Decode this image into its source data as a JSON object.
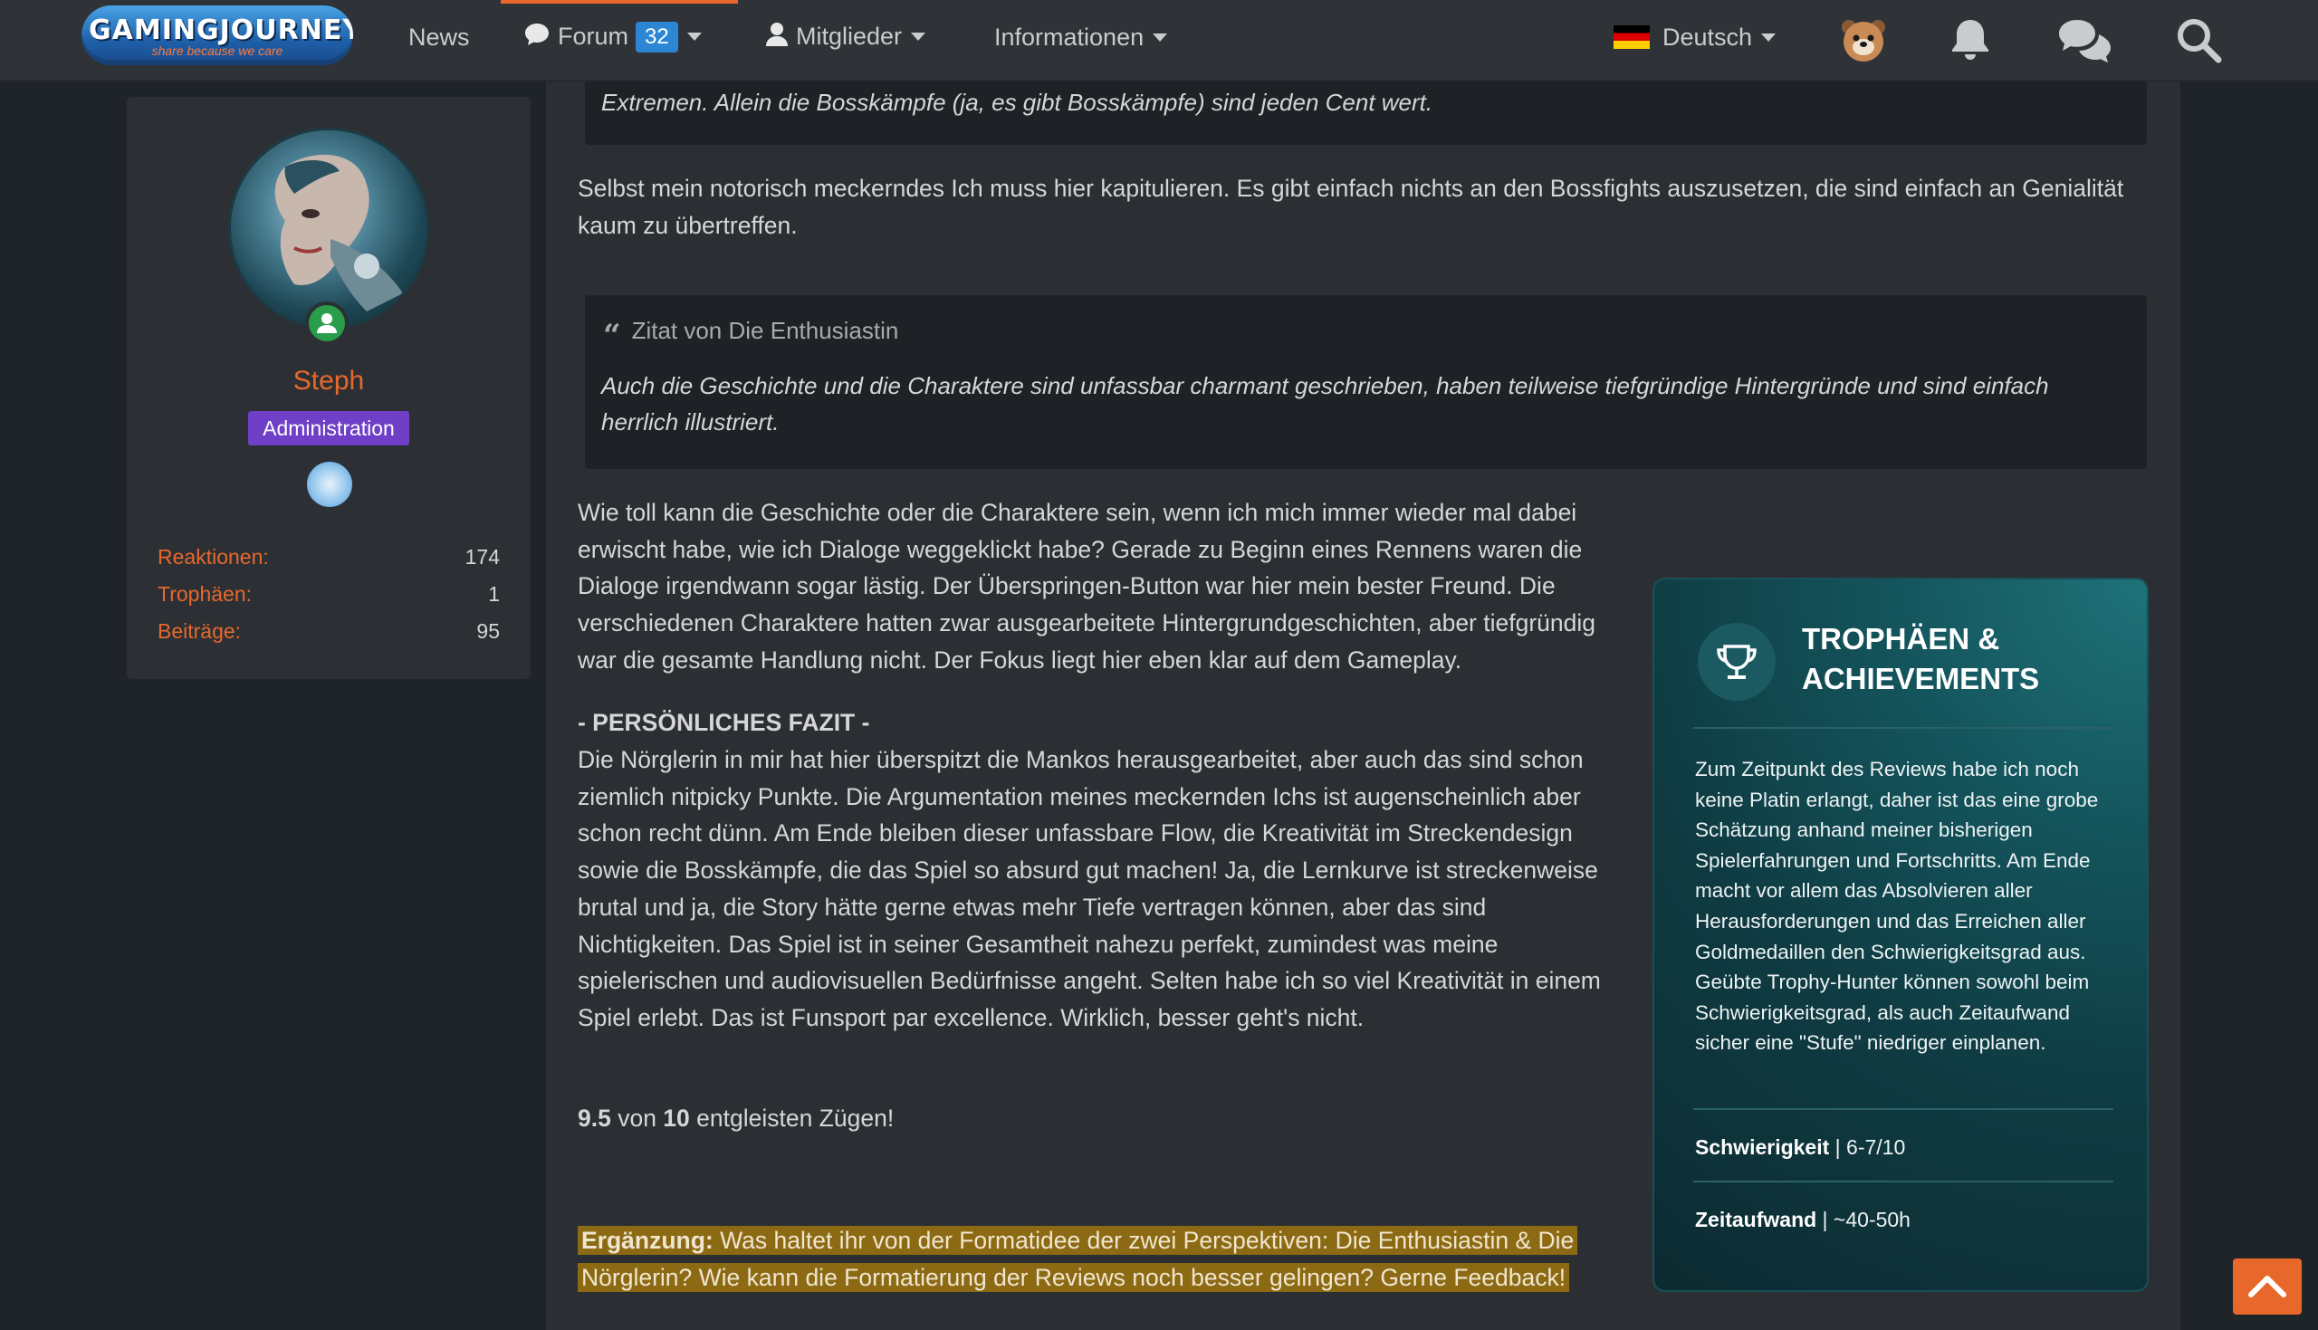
{
  "header": {
    "logo_title": "GAMINGJOURNEYS",
    "logo_tagline": "share because we care",
    "nav_news": "News",
    "nav_forum": "Forum",
    "forum_badge": "32",
    "nav_members": "Mitglieder",
    "nav_info": "Informationen",
    "language": "Deutsch",
    "accent_color": "#e8682b"
  },
  "user": {
    "name": "Steph",
    "role": "Administration",
    "stats": [
      {
        "label": "Reaktionen:",
        "value": "174"
      },
      {
        "label": "Trophäen:",
        "value": "1"
      },
      {
        "label": "Beiträge:",
        "value": "95"
      }
    ]
  },
  "post": {
    "quote_top_text": "Extremen. Allein die Bosskämpfe (ja, es gibt Bosskämpfe) sind jeden Cent wert.",
    "para1": "Selbst mein notorisch meckerndes Ich muss hier kapitulieren. Es gibt einfach nichts an den Bossfights auszusetzen, die sind einfach an Genialität kaum zu übertreffen.",
    "quote2_author": "Zitat von Die Enthusiastin",
    "quote2_text": "Auch die Geschichte und die Charaktere sind unfassbar charmant geschrieben, haben teilweise tiefgründige Hintergründe und sind einfach herrlich illustriert.",
    "para2": "Wie toll kann die Geschichte oder die Charaktere sein, wenn ich mich immer wieder mal dabei erwischt habe, wie ich Dialoge weggeklickt habe? Gerade zu Beginn eines Rennens waren die Dialoge irgendwann sogar lästig. Der Überspringen-Button war hier mein bester Freund. Die verschiedenen Charaktere hatten zwar ausgearbeitete Hintergrundgeschichten, aber tiefgründig war die gesamte Handlung nicht. Der Fokus liegt hier eben klar auf dem Gameplay.",
    "fazit_heading": "- PERSÖNLICHES FAZIT -",
    "fazit_text": "Die Nörglerin in mir hat hier überspitzt die Mankos herausgearbeitet, aber auch das sind schon ziemlich nitpicky Punkte. Die Argumentation meines meckernden Ichs ist augenscheinlich aber schon recht dünn. Am Ende bleiben dieser unfassbare Flow, die Kreativität im Streckendesign sowie die Bosskämpfe, die das Spiel so absurd gut machen! Ja, die Lernkurve ist streckenweise brutal und ja, die Story hätte gerne etwas mehr Tiefe vertragen können, aber das sind Nichtigkeiten. Das Spiel ist in seiner Gesamtheit nahezu perfekt, zumindest was meine spielerischen und audiovisuellen Bedürfnisse angeht. Selten habe ich so viel Kreativität in einem Spiel erlebt. Das ist Funsport par excellence. Wirklich, besser geht's nicht.",
    "score_value": "9.5",
    "score_mid": " von ",
    "score_max": "10",
    "score_suffix": " entgleisten Zügen!",
    "addendum_label": "Ergänzung:",
    "addendum_text": " Was haltet ihr von der Formatidee der zwei Perspektiven: Die Enthusiastin & Die Nörglerin? Wie kann die Formatierung der Reviews noch besser gelingen? Gerne Feedback!"
  },
  "trophy_box": {
    "title": "TROPHÄEN & ACHIEVEMENTS",
    "description": "Zum Zeitpunkt des Reviews habe ich noch keine Platin erlangt, daher ist das eine grobe Schätzung anhand meiner bisherigen Spielerfahrungen und Fortschritts. Am Ende macht vor allem das Absolvieren aller Herausforderungen und das Erreichen aller Goldmedaillen den Schwierigkeitsgrad aus. Geübte Trophy-Hunter können sowohl beim Schwierigkeitsgrad, als auch Zeitaufwand sicher eine \"Stufe\" niedriger einplanen.",
    "difficulty_label": "Schwierigkeit",
    "difficulty_value": " | 6-7/10",
    "time_label": "Zeitaufwand",
    "time_value": " | ~40-50h"
  },
  "icons": [
    "forum-icon",
    "members-icon",
    "flag-de-icon",
    "avatar-bear-icon",
    "bell-icon",
    "conversations-icon",
    "search-icon",
    "quote-icon",
    "trophy-icon",
    "online-icon",
    "rank-icon",
    "arrow-up-icon"
  ]
}
